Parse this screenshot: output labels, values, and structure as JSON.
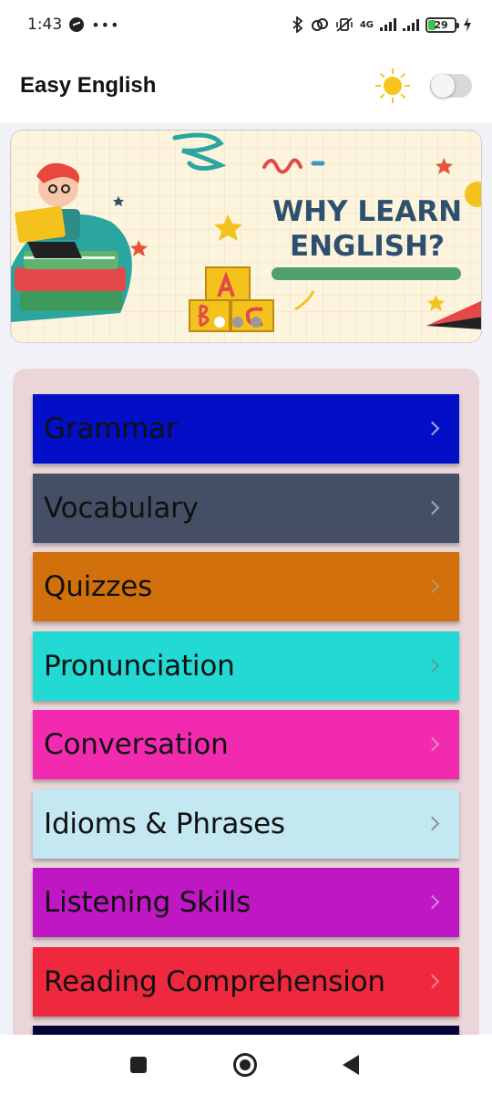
{
  "status_bar": {
    "time": "1:43",
    "network": "4G",
    "battery": "29",
    "icons": [
      "messenger-icon",
      "more-dots-icon",
      "bluetooth-icon",
      "link-icon",
      "vibrate-off-icon",
      "signal-icon",
      "battery-icon",
      "charging-icon"
    ]
  },
  "app_bar": {
    "title": "Easy English",
    "theme_icon": "sun-icon",
    "dark_mode_enabled": false
  },
  "banner": {
    "headline": "WHY LEARN ENGLISH?",
    "page_index": 0,
    "page_count": 3,
    "colors": {
      "background": "#fcf4dd",
      "headline": "#2f4f6f",
      "underline": "#4fa06a"
    }
  },
  "menu": {
    "items": [
      {
        "label": "Grammar",
        "color": "#020fc7"
      },
      {
        "label": "Vocabulary",
        "color": "#444f66"
      },
      {
        "label": "Quizzes",
        "color": "#d2700c"
      },
      {
        "label": "Pronunciation",
        "color": "#22d9d4"
      },
      {
        "label": "Conversation",
        "color": "#f22ab0"
      },
      {
        "label": "Idioms & Phrases",
        "color": "#c4e8f2"
      },
      {
        "label": "Listening Skills",
        "color": "#c017c4"
      },
      {
        "label": "Reading Comprehension",
        "color": "#ee283d"
      }
    ],
    "panel_color": "#ead6d8"
  },
  "nav_bar": {
    "buttons": [
      "recents-icon",
      "home-icon",
      "back-icon"
    ]
  }
}
